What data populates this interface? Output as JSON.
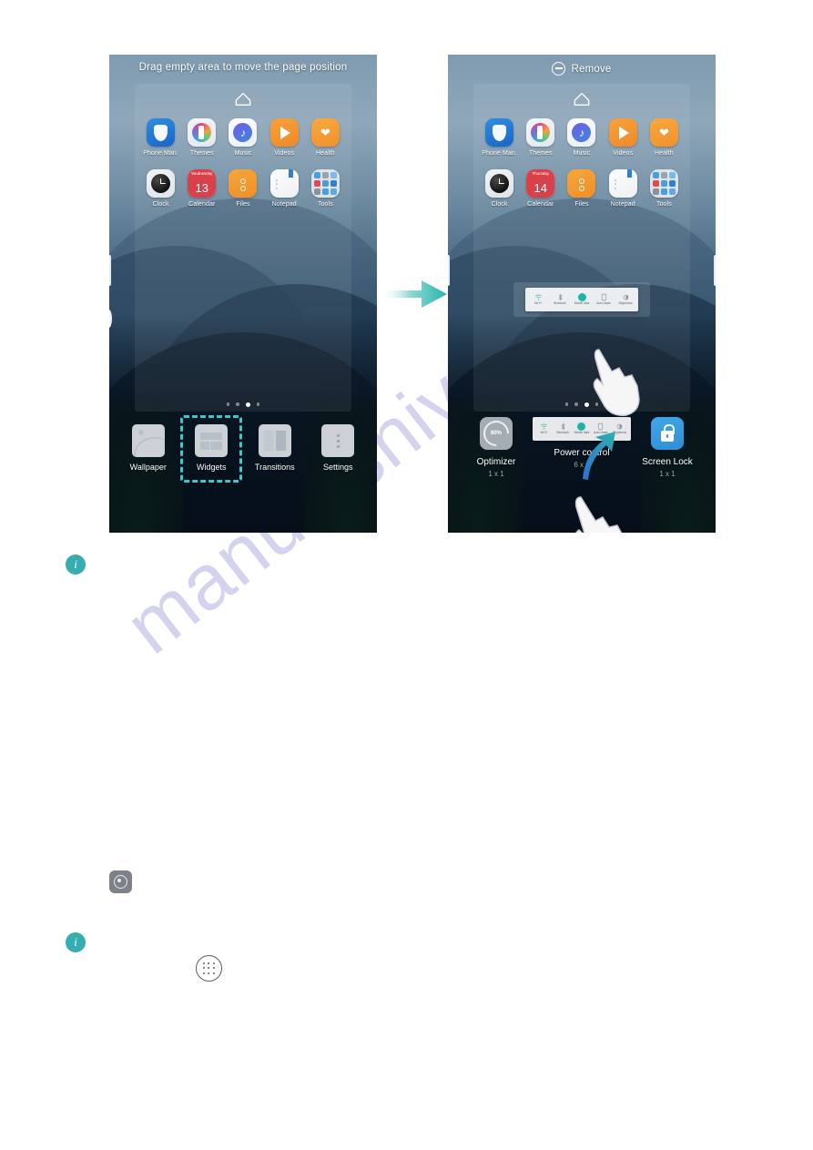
{
  "document": {
    "watermark": "manualshive"
  },
  "figure": {
    "flow_arrow_icon": "arrow-right-icon",
    "left_phone": {
      "header": {
        "text": "Drag empty area to move the page position"
      },
      "home_indicator_icon": "home-icon",
      "apps_row1": [
        {
          "label": "Phone Man.",
          "icon": "phone-manager-icon"
        },
        {
          "label": "Themes",
          "icon": "themes-icon"
        },
        {
          "label": "Music",
          "icon": "music-icon"
        },
        {
          "label": "Videos",
          "icon": "videos-icon"
        },
        {
          "label": "Health",
          "icon": "health-icon"
        }
      ],
      "apps_row2": [
        {
          "label": "Clock",
          "icon": "clock-icon"
        },
        {
          "label": "Calendar",
          "icon": "calendar-icon",
          "weekday": "Wednesday",
          "day": "13"
        },
        {
          "label": "Files",
          "icon": "files-icon"
        },
        {
          "label": "Notepad",
          "icon": "notepad-icon"
        },
        {
          "label": "Tools",
          "icon": "tools-folder-icon"
        }
      ],
      "page_dots": {
        "count": 4,
        "active_index": 2
      },
      "tray": [
        {
          "label": "Wallpaper",
          "icon": "wallpaper-icon",
          "selected": false
        },
        {
          "label": "Widgets",
          "icon": "widgets-icon",
          "selected": true
        },
        {
          "label": "Transitions",
          "icon": "transitions-icon",
          "selected": false
        },
        {
          "label": "Settings",
          "icon": "settings-icon",
          "selected": false
        }
      ]
    },
    "right_phone": {
      "header": {
        "text": "Remove",
        "icon": "minus-circle-icon"
      },
      "home_indicator_icon": "home-icon",
      "apps_row1": [
        {
          "label": "Phone Man.",
          "icon": "phone-manager-icon"
        },
        {
          "label": "Themes",
          "icon": "themes-icon"
        },
        {
          "label": "Music",
          "icon": "music-icon"
        },
        {
          "label": "Videos",
          "icon": "videos-icon"
        },
        {
          "label": "Health",
          "icon": "health-icon"
        }
      ],
      "apps_row2": [
        {
          "label": "Clock",
          "icon": "clock-icon"
        },
        {
          "label": "Calendar",
          "icon": "calendar-icon",
          "weekday": "Thursday",
          "day": "14"
        },
        {
          "label": "Files",
          "icon": "files-icon"
        },
        {
          "label": "Notepad",
          "icon": "notepad-icon"
        },
        {
          "label": "Tools",
          "icon": "tools-folder-icon"
        }
      ],
      "page_dots": {
        "count": 4,
        "active_index": 2
      },
      "dragged_widget": {
        "name": "power-control-widget",
        "toggles": [
          {
            "label": "Wi-Fi",
            "icon": "wifi-icon",
            "active": false
          },
          {
            "label": "Bluetooth",
            "icon": "bluetooth-icon",
            "active": false
          },
          {
            "label": "Mobile data",
            "icon": "data-icon",
            "active": true
          },
          {
            "label": "Auto-rotate",
            "icon": "rotate-icon",
            "active": false
          },
          {
            "label": "Brightness",
            "icon": "brightness-icon",
            "active": false
          }
        ]
      },
      "widgets": [
        {
          "name": "Optimizer",
          "size": "1 x 1",
          "icon": "optimizer-icon",
          "badge": "80%"
        },
        {
          "name": "Power control",
          "size": "6 x 1",
          "icon": "power-control-icon"
        },
        {
          "name": "Screen Lock",
          "size": "1 x 1",
          "icon": "screen-lock-icon"
        }
      ],
      "drag_arrow_icon": "drag-up-arrow-icon",
      "hand_cursor_icon": "hand-pointer-icon"
    }
  },
  "notes": {
    "info_icon_1": "info-icon",
    "info_icon_2": "info-icon",
    "gear_square_icon": "optimizer-shortcut-icon",
    "app_drawer_icon": "app-drawer-icon"
  },
  "colors": {
    "accent_teal": "#36aeb0",
    "selection_teal": "#3fc6c6",
    "watermark": "#d3d3ef"
  }
}
